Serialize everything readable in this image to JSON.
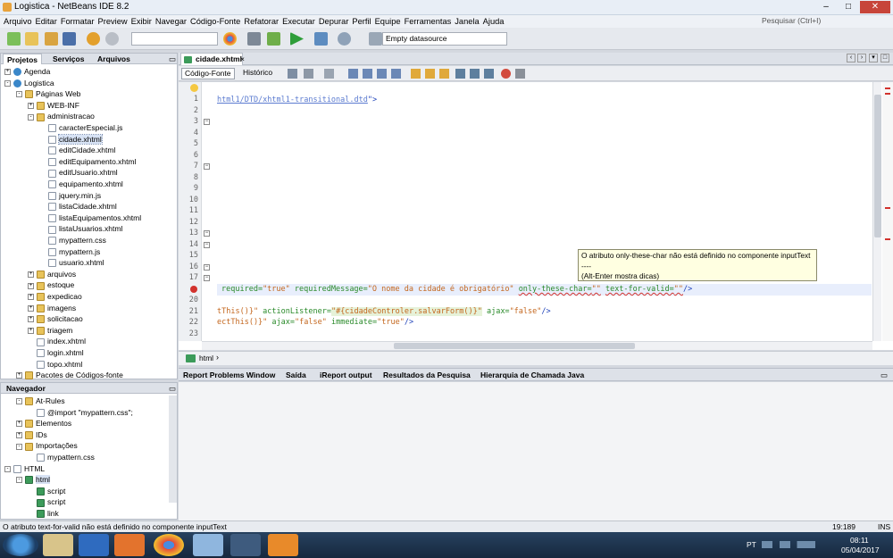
{
  "window": {
    "title": "Logistica - NetBeans IDE 8.2",
    "minimize": "–",
    "maximize": "□",
    "close": "✕"
  },
  "menu": [
    "Arquivo",
    "Editar",
    "Formatar",
    "Preview",
    "Exibir",
    "Navegar",
    "Código-Fonte",
    "Refatorar",
    "Executar",
    "Depurar",
    "Perfil",
    "Equipe",
    "Ferramentas",
    "Janela",
    "Ajuda"
  ],
  "search": {
    "placeholder": "Pesquisar (Ctrl+I)"
  },
  "toolbar": {
    "datasource": "Empty datasource"
  },
  "projects": {
    "tabs": [
      "Projetos",
      "Serviços",
      "Arquivos"
    ],
    "tree": [
      {
        "label": "Agenda",
        "icon": "globe",
        "indent": 0,
        "toggle": "+"
      },
      {
        "label": "Logistica",
        "icon": "globe",
        "indent": 0,
        "toggle": "-"
      },
      {
        "label": "Páginas Web",
        "icon": "folder",
        "indent": 1,
        "toggle": "-"
      },
      {
        "label": "WEB-INF",
        "icon": "folder",
        "indent": 2,
        "toggle": "+"
      },
      {
        "label": "administracao",
        "icon": "folder",
        "indent": 2,
        "toggle": "-"
      },
      {
        "label": "caracterEspecial.js",
        "icon": "file",
        "indent": 3
      },
      {
        "label": "cidade.xhtml",
        "icon": "file",
        "indent": 3,
        "selected": true
      },
      {
        "label": "editCidade.xhtml",
        "icon": "file",
        "indent": 3
      },
      {
        "label": "editEquipamento.xhtml",
        "icon": "file",
        "indent": 3
      },
      {
        "label": "editUsuario.xhtml",
        "icon": "file",
        "indent": 3
      },
      {
        "label": "equipamento.xhtml",
        "icon": "file",
        "indent": 3
      },
      {
        "label": "jquery.min.js",
        "icon": "file",
        "indent": 3
      },
      {
        "label": "listaCidade.xhtml",
        "icon": "file",
        "indent": 3
      },
      {
        "label": "listaEquipamentos.xhtml",
        "icon": "file",
        "indent": 3
      },
      {
        "label": "listaUsuarios.xhtml",
        "icon": "file",
        "indent": 3
      },
      {
        "label": "mypattern.css",
        "icon": "file",
        "indent": 3
      },
      {
        "label": "mypattern.js",
        "icon": "file",
        "indent": 3
      },
      {
        "label": "usuario.xhtml",
        "icon": "file",
        "indent": 3
      },
      {
        "label": "arquivos",
        "icon": "folder",
        "indent": 2,
        "toggle": "+"
      },
      {
        "label": "estoque",
        "icon": "folder",
        "indent": 2,
        "toggle": "+"
      },
      {
        "label": "expedicao",
        "icon": "folder",
        "indent": 2,
        "toggle": "+"
      },
      {
        "label": "imagens",
        "icon": "folder",
        "indent": 2,
        "toggle": "+"
      },
      {
        "label": "solicitacao",
        "icon": "folder",
        "indent": 2,
        "toggle": "+"
      },
      {
        "label": "triagem",
        "icon": "folder",
        "indent": 2,
        "toggle": "+"
      },
      {
        "label": "index.xhtml",
        "icon": "file",
        "indent": 2
      },
      {
        "label": "login.xhtml",
        "icon": "file",
        "indent": 2
      },
      {
        "label": "topo.xhtml",
        "icon": "file",
        "indent": 2
      },
      {
        "label": "Pacotes de Códigos-fonte",
        "icon": "folder",
        "indent": 1,
        "toggle": "+"
      }
    ]
  },
  "navigator": {
    "title": "Navegador",
    "tree": [
      {
        "label": "At-Rules",
        "indent": 1,
        "icon": "folder",
        "toggle": "-"
      },
      {
        "label": "@import \"mypattern.css\";",
        "indent": 2,
        "icon": "file"
      },
      {
        "label": "Elementos",
        "indent": 1,
        "icon": "folder",
        "toggle": "+"
      },
      {
        "label": "IDs",
        "indent": 1,
        "icon": "folder",
        "toggle": "+"
      },
      {
        "label": "Importações",
        "indent": 1,
        "icon": "folder",
        "toggle": "-"
      },
      {
        "label": "mypattern.css",
        "indent": 2,
        "icon": "file"
      },
      {
        "label": "HTML",
        "indent": 0,
        "icon": "file",
        "toggle": "-"
      },
      {
        "label": "html",
        "indent": 1,
        "icon": "tag",
        "toggle": "-",
        "selected": true
      },
      {
        "label": "script",
        "indent": 2,
        "icon": "tag"
      },
      {
        "label": "script",
        "indent": 2,
        "icon": "tag"
      },
      {
        "label": "link",
        "indent": 2,
        "icon": "tag"
      }
    ]
  },
  "editor": {
    "tab": "cidade.xhtml",
    "subtabs": [
      "Código-Fonte",
      "Histórico"
    ],
    "line_numbers": [
      "1",
      "2",
      "3",
      "4",
      "5",
      "6",
      "7",
      "8",
      "9",
      "10",
      "11",
      "12",
      "13",
      "14",
      "15",
      "16",
      "17",
      "",
      "20",
      "21",
      "22",
      "23"
    ],
    "line2": "html1/DTD/xhtml1-transitional.dtd",
    "line2_end": "\">",
    "line19": {
      "a1": "required=",
      "v1": "\"true\"",
      "a2": "requiredMessage=",
      "v2": "\"O nome da cidade é obrigatório\"",
      "a3": "only-these-char=",
      "v3": "\"\"",
      "a4": "text-for-valid=",
      "v4": "\"\"",
      "end": "/>"
    },
    "line21": {
      "p1": "tThis()}\"",
      "a1": " actionListener=",
      "v1": "\"#{cidadeControler.salvarForm()}\"",
      "a2": " ajax=",
      "v2": "\"false\"",
      "end": "/>"
    },
    "line22": {
      "p1": "ectThis()}\"",
      "a1": " ajax=",
      "v1": "\"false\"",
      "a2": " immediate=",
      "v2": "\"true\"",
      "end": "/>"
    },
    "breadcrumb": "html",
    "tooltip": {
      "line1": "O atributo only-these-char não está definido no componente inputText",
      "line2": "----",
      "line3": "(Alt-Enter mostra dicas)"
    }
  },
  "output_tabs": [
    "Report Problems Window",
    "Saída",
    "iReport output",
    "Resultados da Pesquisa",
    "Hierarquia de Chamada Java"
  ],
  "status": {
    "message": "O atributo text-for-valid não está definido no componente inputText",
    "position": "19:189",
    "mode": "INS"
  },
  "taskbar": {
    "lang": "PT",
    "time": "08:11",
    "date": "05/04/2017"
  }
}
